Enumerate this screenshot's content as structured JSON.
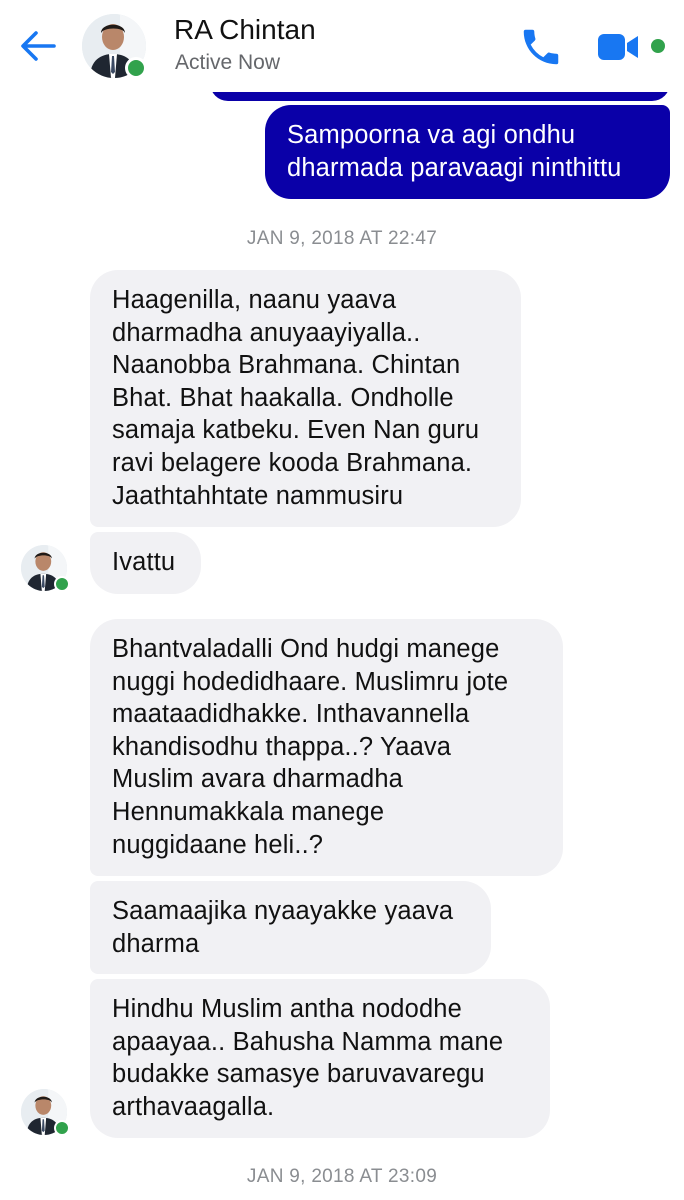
{
  "header": {
    "contact_name": "RA Chintan",
    "status": "Active Now",
    "back_icon": "back-arrow-icon",
    "call_icon": "phone-icon",
    "video_icon": "video-camera-icon",
    "accent_color": "#1877f2",
    "online_color": "#31a24c"
  },
  "conversation": {
    "sent_color": "#0a00a8",
    "received_color": "#f1f1f4",
    "messages": [
      {
        "direction": "sent",
        "text": "Sampoorna va agi ondhu\ndharmada paravaagi ninthittu"
      },
      {
        "type": "timestamp",
        "text": "JAN 9, 2018 AT 22:47"
      },
      {
        "direction": "received",
        "text": "Haagenilla, naanu yaava\ndharmadha anuyaayiyalla..\nNaanobba Brahmana.  Chintan\nBhat. Bhat haakalla.  Ondholle\nsamaja katbeku. Even Nan guru\nravi belagere kooda Brahmana.\nJaathtahhtate nammusiru"
      },
      {
        "direction": "received",
        "text": "Ivattu"
      },
      {
        "direction": "received",
        "text": "Bhantvaladalli Ond hudgi manege\nnuggi hodedidhaare. Muslimru jote\nmaataadidhakke. Inthavannella\nkhandisodhu thappa..? Yaava\nMuslim avara dharmadha\nHennumakkala manege\nnuggidaane heli..?"
      },
      {
        "direction": "received",
        "text": "Saamaajika nyaayakke yaava\ndharma"
      },
      {
        "direction": "received",
        "text": "Hindhu Muslim antha nododhe\napaayaa.. Bahusha Namma mane\nbudakke samasye baruvavaregu\narthavaagalla."
      },
      {
        "type": "timestamp",
        "text": "JAN 9, 2018 AT 23:09"
      }
    ]
  }
}
